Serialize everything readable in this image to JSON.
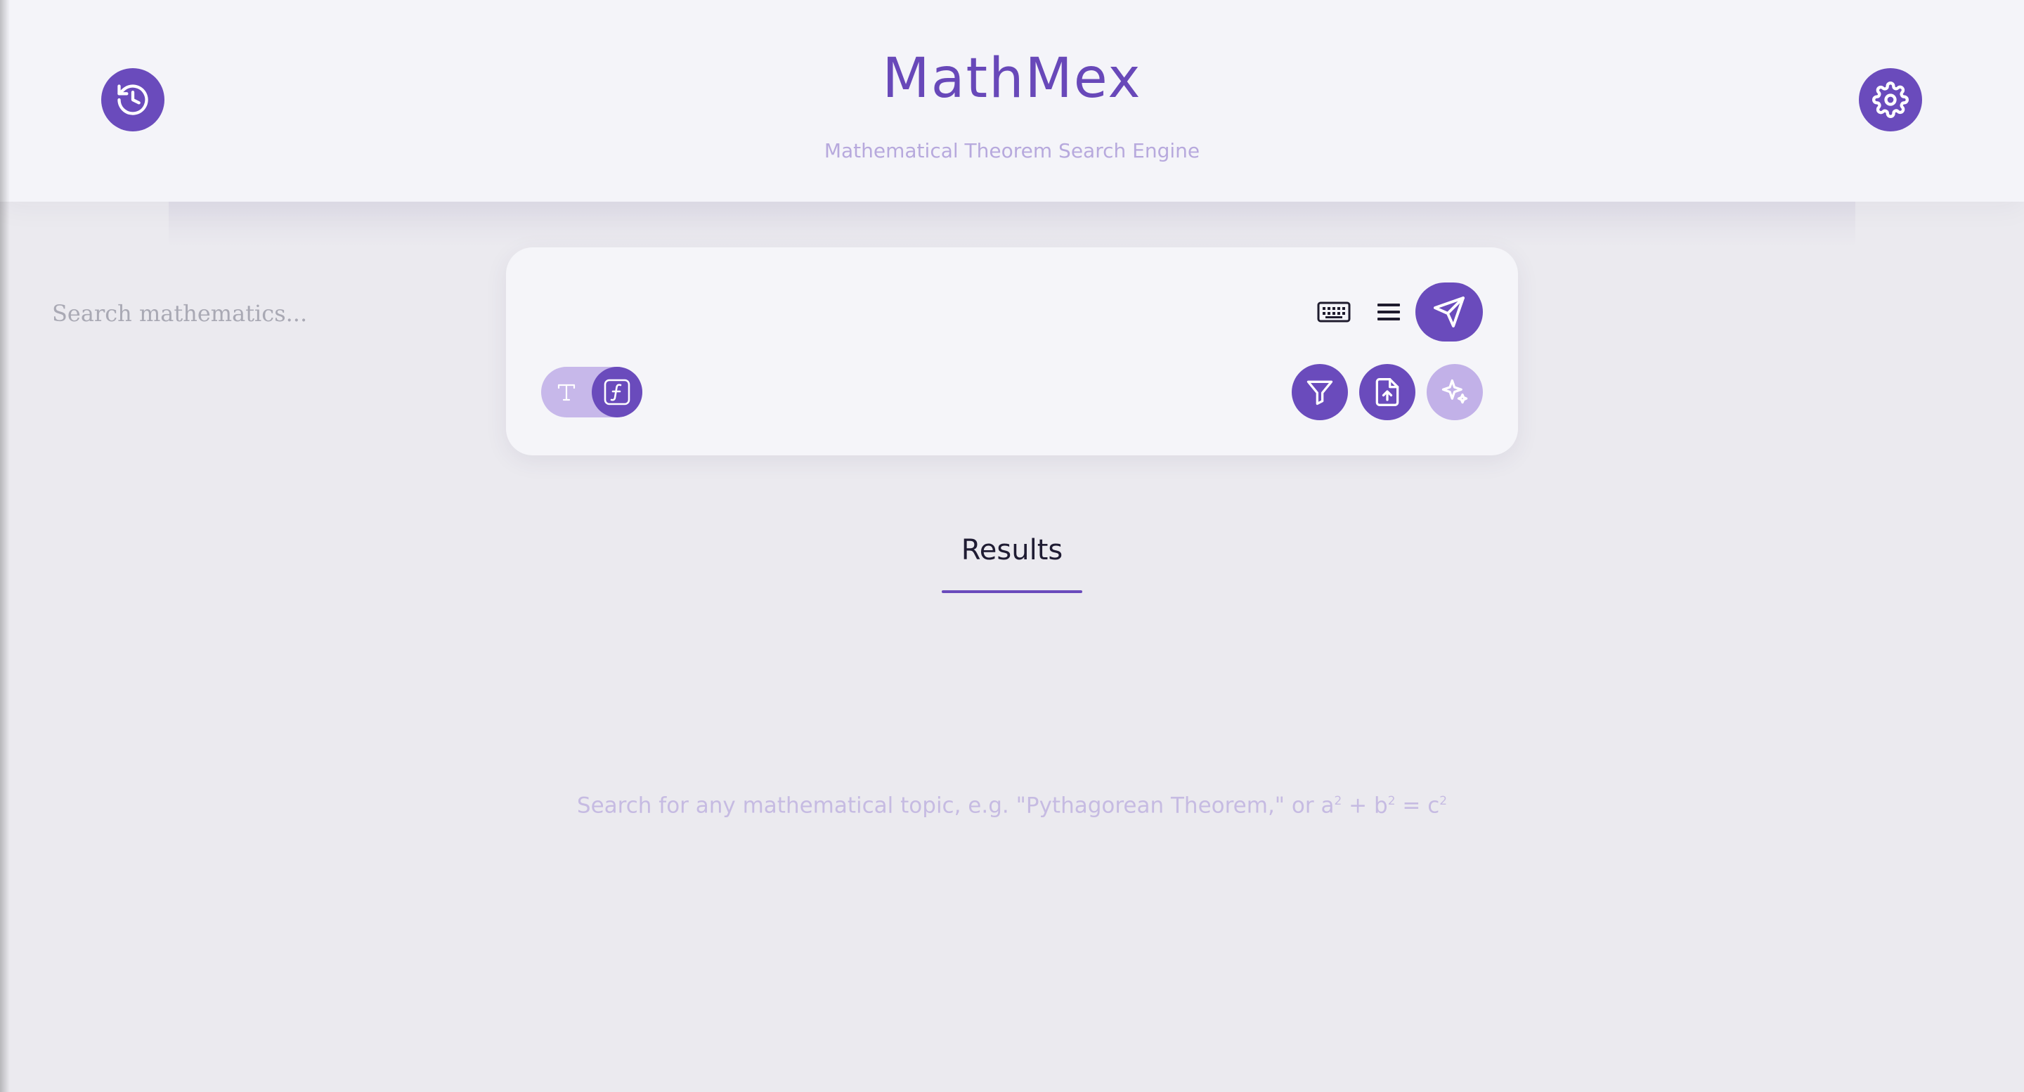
{
  "header": {
    "title": "MathMex",
    "subtitle": "Mathematical Theorem Search Engine",
    "history_icon": "history-icon",
    "settings_icon": "gear-icon"
  },
  "search": {
    "placeholder": "Search mathematics...",
    "value": "",
    "keyboard_icon": "keyboard-icon",
    "menu_icon": "menu-icon",
    "send_icon": "send-icon",
    "mode_toggle": {
      "options": [
        "T",
        "f"
      ],
      "selected": "f"
    },
    "actions": [
      {
        "icon": "filter-icon"
      },
      {
        "icon": "file-upload-icon"
      },
      {
        "icon": "sparkles-icon"
      }
    ]
  },
  "results": {
    "tab_label": "Results",
    "hint_prefix": "Search for any mathematical topic, e.g. \"Pythagorean Theorem,\" or a",
    "hint_sup1": "2",
    "hint_mid1": " + b",
    "hint_sup2": "2",
    "hint_mid2": " = c",
    "hint_sup3": "2"
  },
  "colors": {
    "accent": "#6a4bbc",
    "accent_light": "#c2b1e8",
    "header_bg": "#f4f4f9",
    "page_bg": "#ebeaef",
    "hint_text": "#c6bbe2"
  }
}
